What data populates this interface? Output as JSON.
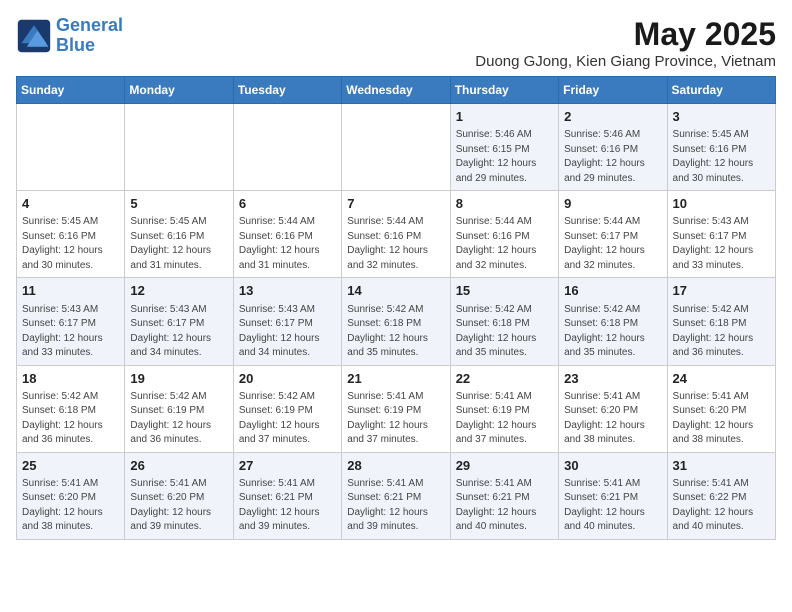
{
  "logo": {
    "line1": "General",
    "line2": "Blue"
  },
  "title": "May 2025",
  "subtitle": "Duong GJong, Kien Giang Province, Vietnam",
  "days_of_week": [
    "Sunday",
    "Monday",
    "Tuesday",
    "Wednesday",
    "Thursday",
    "Friday",
    "Saturday"
  ],
  "weeks": [
    [
      {
        "day": "",
        "info": ""
      },
      {
        "day": "",
        "info": ""
      },
      {
        "day": "",
        "info": ""
      },
      {
        "day": "",
        "info": ""
      },
      {
        "day": "1",
        "info": "Sunrise: 5:46 AM\nSunset: 6:15 PM\nDaylight: 12 hours\nand 29 minutes."
      },
      {
        "day": "2",
        "info": "Sunrise: 5:46 AM\nSunset: 6:16 PM\nDaylight: 12 hours\nand 29 minutes."
      },
      {
        "day": "3",
        "info": "Sunrise: 5:45 AM\nSunset: 6:16 PM\nDaylight: 12 hours\nand 30 minutes."
      }
    ],
    [
      {
        "day": "4",
        "info": "Sunrise: 5:45 AM\nSunset: 6:16 PM\nDaylight: 12 hours\nand 30 minutes."
      },
      {
        "day": "5",
        "info": "Sunrise: 5:45 AM\nSunset: 6:16 PM\nDaylight: 12 hours\nand 31 minutes."
      },
      {
        "day": "6",
        "info": "Sunrise: 5:44 AM\nSunset: 6:16 PM\nDaylight: 12 hours\nand 31 minutes."
      },
      {
        "day": "7",
        "info": "Sunrise: 5:44 AM\nSunset: 6:16 PM\nDaylight: 12 hours\nand 32 minutes."
      },
      {
        "day": "8",
        "info": "Sunrise: 5:44 AM\nSunset: 6:16 PM\nDaylight: 12 hours\nand 32 minutes."
      },
      {
        "day": "9",
        "info": "Sunrise: 5:44 AM\nSunset: 6:17 PM\nDaylight: 12 hours\nand 32 minutes."
      },
      {
        "day": "10",
        "info": "Sunrise: 5:43 AM\nSunset: 6:17 PM\nDaylight: 12 hours\nand 33 minutes."
      }
    ],
    [
      {
        "day": "11",
        "info": "Sunrise: 5:43 AM\nSunset: 6:17 PM\nDaylight: 12 hours\nand 33 minutes."
      },
      {
        "day": "12",
        "info": "Sunrise: 5:43 AM\nSunset: 6:17 PM\nDaylight: 12 hours\nand 34 minutes."
      },
      {
        "day": "13",
        "info": "Sunrise: 5:43 AM\nSunset: 6:17 PM\nDaylight: 12 hours\nand 34 minutes."
      },
      {
        "day": "14",
        "info": "Sunrise: 5:42 AM\nSunset: 6:18 PM\nDaylight: 12 hours\nand 35 minutes."
      },
      {
        "day": "15",
        "info": "Sunrise: 5:42 AM\nSunset: 6:18 PM\nDaylight: 12 hours\nand 35 minutes."
      },
      {
        "day": "16",
        "info": "Sunrise: 5:42 AM\nSunset: 6:18 PM\nDaylight: 12 hours\nand 35 minutes."
      },
      {
        "day": "17",
        "info": "Sunrise: 5:42 AM\nSunset: 6:18 PM\nDaylight: 12 hours\nand 36 minutes."
      }
    ],
    [
      {
        "day": "18",
        "info": "Sunrise: 5:42 AM\nSunset: 6:18 PM\nDaylight: 12 hours\nand 36 minutes."
      },
      {
        "day": "19",
        "info": "Sunrise: 5:42 AM\nSunset: 6:19 PM\nDaylight: 12 hours\nand 36 minutes."
      },
      {
        "day": "20",
        "info": "Sunrise: 5:42 AM\nSunset: 6:19 PM\nDaylight: 12 hours\nand 37 minutes."
      },
      {
        "day": "21",
        "info": "Sunrise: 5:41 AM\nSunset: 6:19 PM\nDaylight: 12 hours\nand 37 minutes."
      },
      {
        "day": "22",
        "info": "Sunrise: 5:41 AM\nSunset: 6:19 PM\nDaylight: 12 hours\nand 37 minutes."
      },
      {
        "day": "23",
        "info": "Sunrise: 5:41 AM\nSunset: 6:20 PM\nDaylight: 12 hours\nand 38 minutes."
      },
      {
        "day": "24",
        "info": "Sunrise: 5:41 AM\nSunset: 6:20 PM\nDaylight: 12 hours\nand 38 minutes."
      }
    ],
    [
      {
        "day": "25",
        "info": "Sunrise: 5:41 AM\nSunset: 6:20 PM\nDaylight: 12 hours\nand 38 minutes."
      },
      {
        "day": "26",
        "info": "Sunrise: 5:41 AM\nSunset: 6:20 PM\nDaylight: 12 hours\nand 39 minutes."
      },
      {
        "day": "27",
        "info": "Sunrise: 5:41 AM\nSunset: 6:21 PM\nDaylight: 12 hours\nand 39 minutes."
      },
      {
        "day": "28",
        "info": "Sunrise: 5:41 AM\nSunset: 6:21 PM\nDaylight: 12 hours\nand 39 minutes."
      },
      {
        "day": "29",
        "info": "Sunrise: 5:41 AM\nSunset: 6:21 PM\nDaylight: 12 hours\nand 40 minutes."
      },
      {
        "day": "30",
        "info": "Sunrise: 5:41 AM\nSunset: 6:21 PM\nDaylight: 12 hours\nand 40 minutes."
      },
      {
        "day": "31",
        "info": "Sunrise: 5:41 AM\nSunset: 6:22 PM\nDaylight: 12 hours\nand 40 minutes."
      }
    ]
  ]
}
